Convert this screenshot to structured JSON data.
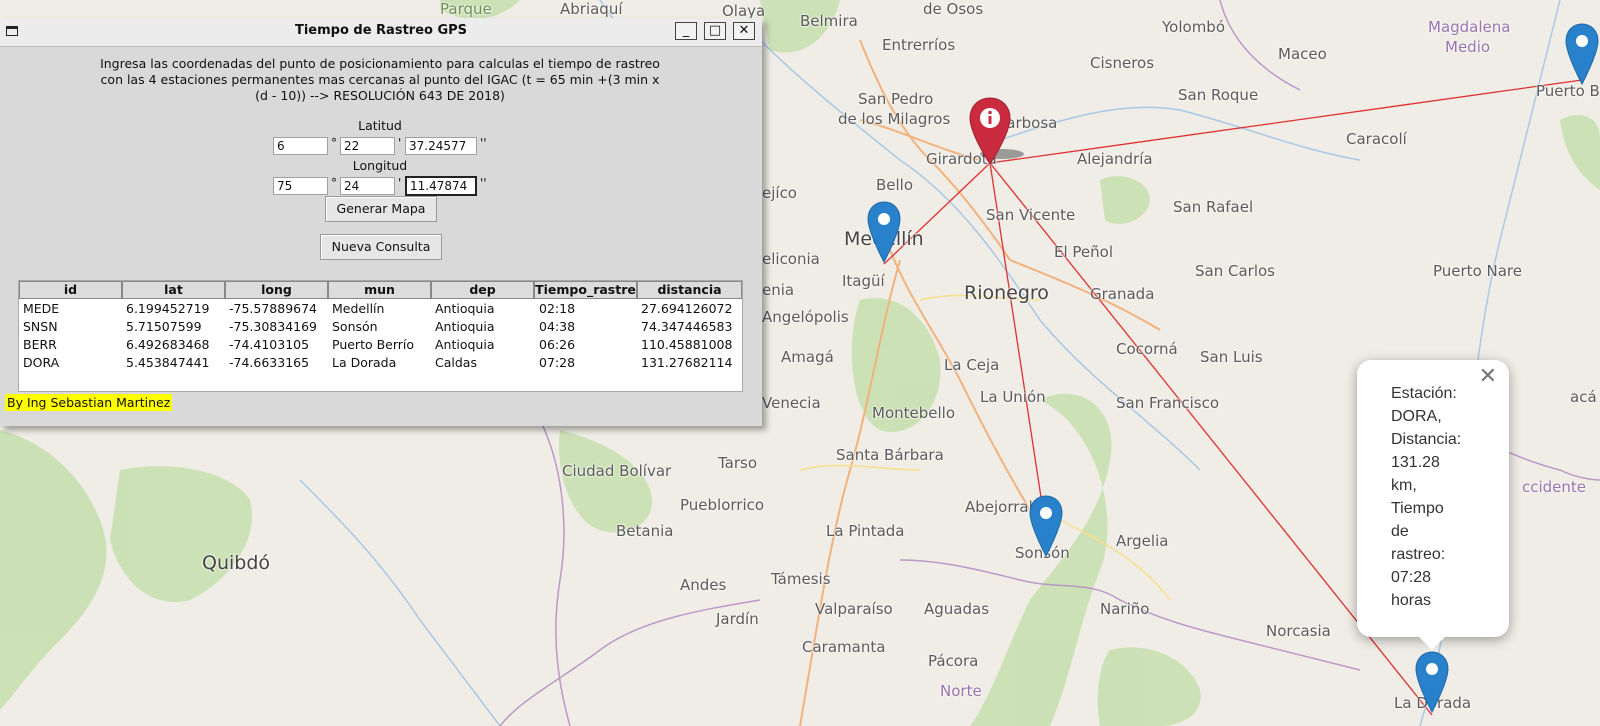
{
  "window": {
    "title": "Tiempo de Rastreo GPS",
    "instructions": "Ingresa las coordenadas del punto de posicionamiento para calculas el tiempo de rastreo\ncon las 4 estaciones permanentes mas cercanas al punto del IGAC (t = 65 min +(3 min x\n(d - 10)) --> RESOLUCIÓN 643 DE 2018)",
    "lat_label": "Latitud",
    "lon_label": "Longitud",
    "lat": {
      "deg": "6",
      "min": "22",
      "sec": "37.24577"
    },
    "lon": {
      "deg": "75",
      "min": "24",
      "sec": "11.47874"
    },
    "deg_symbol": "°",
    "min_symbol": "'",
    "sec_symbol": "''",
    "btn_generate": "Generar Mapa",
    "btn_new": "Nueva Consulta",
    "credit": "By Ing Sebastian Martinez",
    "controls": {
      "minimize": "_",
      "maximize": "□",
      "close": "✕"
    }
  },
  "table": {
    "headers": [
      "id",
      "lat",
      "long",
      "mun",
      "dep",
      "Tiempo_rastre",
      "distancia"
    ],
    "rows": [
      [
        "MEDE",
        "6.199452719",
        "-75.57889674",
        "Medellín",
        "Antioquia",
        "02:18",
        "27.694126072"
      ],
      [
        "SNSN",
        "5.71507599",
        "-75.30834169",
        "Sonsón",
        "Antioquia",
        "04:38",
        "74.347446583"
      ],
      [
        "BERR",
        "6.492683468",
        "-74.4103105",
        "Puerto Berrío",
        "Antioquia",
        "06:26",
        "110.45881008"
      ],
      [
        "DORA",
        "5.453847441",
        "-74.6633165",
        "La Dorada",
        "Caldas",
        "07:28",
        "131.27682114"
      ]
    ]
  },
  "map": {
    "places": [
      "Parque",
      "Abriaquí",
      "Olaya",
      "Belmira",
      "de Osos",
      "Entrerríos",
      "Yolombó",
      "Magdalena",
      "Medio",
      "Cisneros",
      "Maceo",
      "San Pedro",
      "de los Milagros",
      "Barbosa",
      "San Roque",
      "Puerto B",
      "Girardota",
      "Alejandría",
      "Caracolí",
      "ejíco",
      "Bello",
      "San Vicente",
      "San Rafael",
      "Medellín",
      "El Peñol",
      "eliconia",
      "Itagüí",
      "Rionegro",
      "Granada",
      "San Carlos",
      "Puerto Nare",
      "enia",
      "Angelópolis",
      "Amagá",
      "La Ceja",
      "Cocorná",
      "San Luis",
      "La Unión",
      "Montebello",
      "Venecia",
      "San Francisco",
      "acá",
      "Ciudad Bolívar",
      "Tarso",
      "Santa Bárbara",
      "Abejorral",
      "Pueblorrico",
      "La Pintada",
      "Sonsón",
      "Argelia",
      "ccidente",
      "Betania",
      "Quibdó",
      "Andes",
      "Támesis",
      "Valparaíso",
      "Aguadas",
      "Nariño",
      "Jardín",
      "Caramanta",
      "Norcasia",
      "Pácora",
      "Norte",
      "La Dorada"
    ],
    "popup": {
      "text": "Estación:\nDORA,\nDistancia:\n131.28\nkm,\nTiempo\nde\nrastreo:\n07:28\nhoras",
      "close": "✕"
    },
    "colors": {
      "route": "#e03030",
      "station_marker": "#2a81cb",
      "origin_marker": "#cb2b3e"
    }
  }
}
